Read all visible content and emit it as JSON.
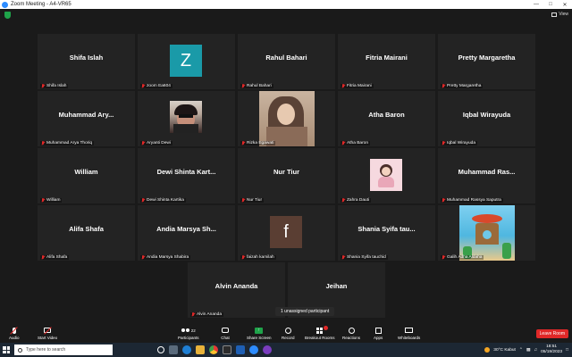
{
  "window": {
    "title": "Zoom Meeting - A4-VR65",
    "view_label": "View"
  },
  "tiles": [
    {
      "name": "Shifa Islah",
      "display": "Shifa Islah"
    },
    {
      "name": "zoom Ea604",
      "avatar_letter": "Z",
      "avatar_color": "#1a9aa8"
    },
    {
      "name": "Rahul Bahari",
      "display": "Rahul Bahari"
    },
    {
      "name": "Fitria Mairani",
      "display": "Fitria Mairani"
    },
    {
      "name": "Pretty Margaretha",
      "display": "Pretty Margaretha"
    },
    {
      "name": "Muhammad Arya Thoriq",
      "display": "Muhammad Ary..."
    },
    {
      "name": "Aryanti Dewi"
    },
    {
      "name": "Rizka Egawati"
    },
    {
      "name": "Atha Baron",
      "display": "Atha Baron"
    },
    {
      "name": "Iqbal Wirayuda",
      "display": "Iqbal Wirayuda"
    },
    {
      "name": "William",
      "display": "William"
    },
    {
      "name": "Dewi Shinta Kartika",
      "display": "Dewi Shinta Kart..."
    },
    {
      "name": "Nur Tiur",
      "display": "Nur Tiur"
    },
    {
      "name": "Zahra Dauti"
    },
    {
      "name": "Muhammad Rassya Saputra",
      "display": "Muhammad Ras..."
    },
    {
      "name": "Alifa Shafa",
      "display": "Alifa Shafa"
    },
    {
      "name": "Andia Marsya Shabira",
      "display": "Andia Marsya Sh..."
    },
    {
      "name": "faizah kamilah",
      "avatar_letter": "f",
      "avatar_color": "#5a3e33"
    },
    {
      "name": "Shania Syifa tauchid",
      "display": "Shania Syifa tau..."
    },
    {
      "name": "Galih Adha Aldaha"
    },
    {
      "name": "Alvin Ananda",
      "display": "Alvin Ananda"
    },
    {
      "name": "Jeihan",
      "display": "Jeihan"
    }
  ],
  "unassigned": "1 unassigned participant",
  "toolbar": {
    "audio": "Audio",
    "video": "Start Video",
    "participants": "Participants",
    "participants_count": "22",
    "chat": "Chat",
    "share": "Share Screen",
    "record": "Record",
    "breakout": "Breakout Rooms",
    "reactions": "Reactions",
    "apps": "Apps",
    "whiteboards": "Whiteboards",
    "leave": "Leave Room"
  },
  "taskbar": {
    "search_placeholder": "Type here to search",
    "weather": "30°C  Kabut",
    "time": "18:51",
    "date": "05/19/2023"
  },
  "colors": {
    "leave": "#e02828",
    "share": "#1fa34a",
    "zoom_blue": "#2d8cff"
  }
}
